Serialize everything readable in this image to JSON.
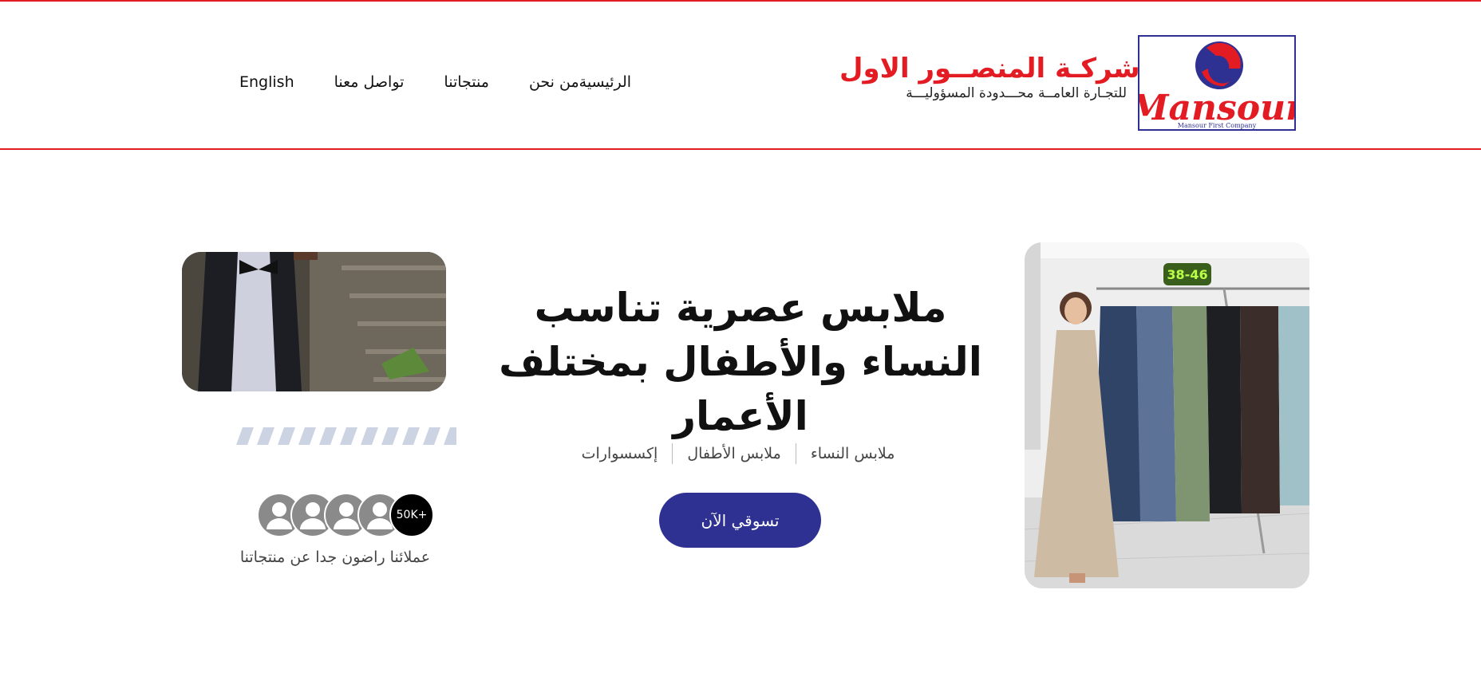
{
  "brand": {
    "logo_text": "Mansour",
    "logo_caption": "Mansour First Company",
    "name_line1": "شركـة المنصــور الاول",
    "name_line2": "للتجـارة العامــة محـــدودة المسؤوليـــة"
  },
  "nav": {
    "items": [
      {
        "label": "الرئيسية"
      },
      {
        "label": "من نحن"
      },
      {
        "label": "منتجاتنا"
      },
      {
        "label": "تواصل معنا"
      },
      {
        "label": "English"
      }
    ]
  },
  "hero": {
    "title": "ملابس عصرية تناسب النساء والأطفال بمختلف الأعمار",
    "categories": [
      "ملابس النساء",
      "ملابس الأطفال",
      "إكسسوارات"
    ],
    "cta_label": "تسوقي الآن",
    "size_badge": "38-46",
    "customers_count": "50K+",
    "customers_text": "عملائنا راضون جدا عن منتجاتنا"
  },
  "colors": {
    "brand_red": "#e31c23",
    "brand_navy": "#2e3192",
    "stripe": "#ccd3e3"
  }
}
